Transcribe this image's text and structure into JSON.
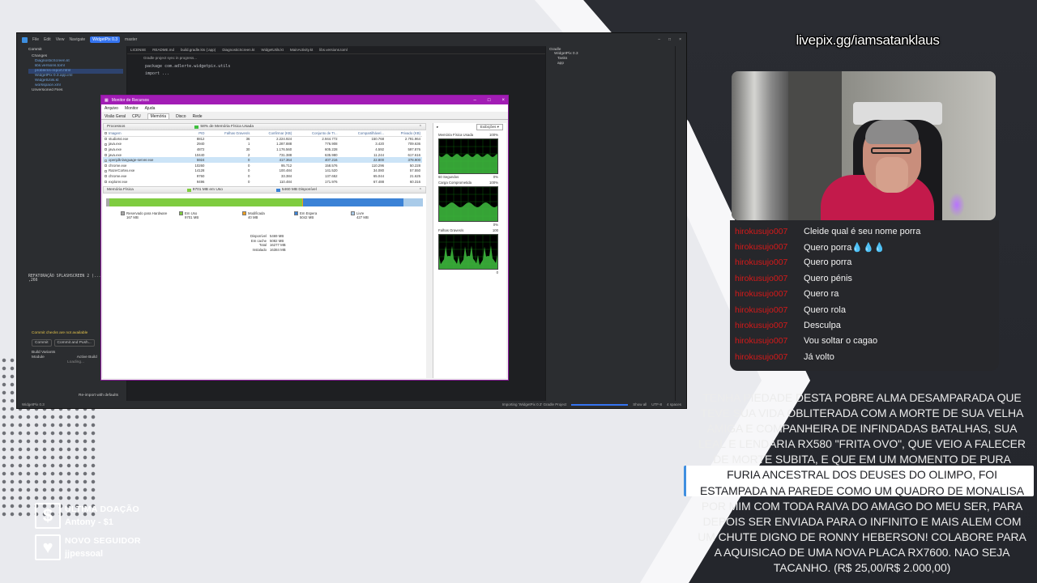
{
  "overlay": {
    "livepix": "livepix.gg/iamsatanklaus",
    "donation_lines": [
      "TENHA PIEDADE DESTA POBRE ALMA DESAMPARADA QUE",
      "TEVE SUA VIDA OBLITERADA COM A MORTE DE SUA VELHA",
      "AMIGA E COMPANHEIRA DE INFINDADAS BATALHAS, SUA",
      "LEAL E LENDARIA RX580 \"FRITA OVO\", QUE VEIO A FALECER",
      "DE MORTE SUBITA, E QUE EM UM MOMENTO DE PURA",
      "FURIA ANCESTRAL DOS DEUSES DO OLIMPO, FOI",
      "ESTAMPADA NA PAREDE COMO UM QUADRO DE MONALISA",
      "POR MIM COM TODA RAIVA DO AMAGO DO MEU SER, PARA",
      "DEPOIS SER ENVIADA PARA O INFINITO E MAIS ALEM COM",
      "UM CHUTE DIGNO DE RONNY HEBERSON! COLABORE PARA",
      "A AQUISICAO DE UMA NOVA PLACA RX7600. NAO SEJA",
      "TACANHO. (R$ 25,00/R$ 2.000,00)"
    ],
    "last_donation_label": "ULTIMA DOAÇÃO",
    "last_donation_value": "Antony - $1",
    "new_follower_label": "NOVO SEGUIDOR",
    "new_follower_value": "jjpessoal",
    "accent_color": "#3f8fe0"
  },
  "chat": [
    {
      "user": "hirokusujo007",
      "message": "Cleide qual é seu nome porra"
    },
    {
      "user": "hirokusujo007",
      "message": "Quero porra💧💧💧"
    },
    {
      "user": "hirokusujo007",
      "message": "Quero porra"
    },
    {
      "user": "hirokusujo007",
      "message": "Quero pénis"
    },
    {
      "user": "hirokusujo007",
      "message": "Quero ra"
    },
    {
      "user": "hirokusujo007",
      "message": "Quero rola"
    },
    {
      "user": "hirokusujo007",
      "message": "Desculpa"
    },
    {
      "user": "hirokusujo007",
      "message": "Vou soltar o cagao"
    },
    {
      "user": "hirokusujo007",
      "message": "Já volto"
    }
  ],
  "ide": {
    "menu": [
      "File",
      "Edit",
      "View",
      "Navigate"
    ],
    "project": "WidgetPix 0.3",
    "branch": "master",
    "tabs": [
      "LICENSE",
      "README.md",
      "build.gradle.kts (:app)",
      "DiagnosticScreen.kt",
      "WidgetUtils.kt",
      "MainActivity.kt",
      "libs.versions.toml"
    ],
    "gradle_note": "Gradle project sync in progress...",
    "code_package": "package com.adlerte.widgetpix.utils",
    "code_import": "import ...",
    "commit_header": "Commit",
    "changes": "Changes",
    "files": [
      "DiagnosticScreen.kt",
      "libs.versions.toml",
      "problems-report.html",
      "WidgetPix 0.3.app.iml",
      "WidgetUtils.kt",
      "workspace.xml"
    ],
    "unversioned": "Unversioned Files",
    "terminal_line1": "REFATORAÇÃO SPLASHSCREEN 2 (...",
    "terminal_line2": ",266",
    "commit_warn": "Commit checks are not available",
    "commit_btn": "Commit",
    "commit_push_btn": "Commit and Push...",
    "build_variants": "Build Variants",
    "module": "Module",
    "active_build": "Active Build",
    "loading": "Loading...",
    "reimport": "Re-import with defaults",
    "gradle_panel": "Gradle",
    "gradle_tree": [
      "WidgetPix 0.3",
      "Tasks",
      "app"
    ],
    "status_left": "WidgetPix 0.3",
    "status_right": "Importing 'WidgetPix 0.3' Gradle Project",
    "show_all": "Show all",
    "encoding": "UTF-8",
    "indent": "4 spaces"
  },
  "resmon": {
    "title": "Monitor de Recursos",
    "menu": [
      "Arquivo",
      "Monitor",
      "Ajuda"
    ],
    "tabs": [
      "Visão Geral",
      "CPU",
      "Memória",
      "Disco",
      "Rede"
    ],
    "active_tab": "Memória",
    "processes_header": "Processos",
    "processes_badge": "58% de Memória Física Usada",
    "columns": [
      "Imagem",
      "PID",
      "Falhas Graves/s",
      "Confirmar (KB)",
      "Conjunto de Tr...",
      "Compartilhável...",
      "Privado (KB)"
    ],
    "rows": [
      {
        "name": "studio64.exe",
        "pid": "8812",
        "hard": "36",
        "commit": "2.224.924",
        "ws": "2.944.772",
        "share": "150.768",
        "priv": "2.791.964"
      },
      {
        "name": "java.exe",
        "pid": "2940",
        "hard": "1",
        "commit": "1.287.888",
        "ws": "776.908",
        "share": "3.420",
        "priv": "709.636"
      },
      {
        "name": "java.exe",
        "pid": "4872",
        "hard": "30",
        "commit": "1.176.560",
        "ws": "605.228",
        "share": "4.592",
        "priv": "597.876"
      },
      {
        "name": "java.exe",
        "pid": "10440",
        "hard": "2",
        "commit": "731.388",
        "ws": "635.980",
        "share": "11.244",
        "priv": "617.616"
      },
      {
        "name": "openjdk-language-server.exe",
        "pid": "5924",
        "hard": "0",
        "commit": "417.364",
        "ws": "407.216",
        "share": "22.800",
        "priv": "378.900"
      },
      {
        "name": "chrome.exe",
        "pid": "10260",
        "hard": "0",
        "commit": "95.712",
        "ws": "158.576",
        "share": "110.296",
        "priv": "50.228"
      },
      {
        "name": "RazerCortex.exe",
        "pid": "14128",
        "hard": "0",
        "commit": "100.484",
        "ws": "141.520",
        "share": "34.080",
        "priv": "57.550"
      },
      {
        "name": "chrome.exe",
        "pid": "9760",
        "hard": "0",
        "commit": "33.384",
        "ws": "137.652",
        "share": "65.044",
        "priv": "21.625"
      },
      {
        "name": "explorer.exe",
        "pid": "9496",
        "hard": "0",
        "commit": "110.484",
        "ws": "171.976",
        "share": "67.488",
        "priv": "60.316"
      }
    ],
    "physical_header": "Memória Física",
    "physical_badge1": "9701 MB em Uso",
    "physical_badge2": "5460 MB Disponível",
    "legend": [
      {
        "label": "Reservado para Hardware",
        "value": "167 MB",
        "color": "#a8a8a8"
      },
      {
        "label": "Em Uso",
        "value": "9701 MB",
        "color": "#7fcc40"
      },
      {
        "label": "Modificada",
        "value": "40 MB",
        "color": "#f0a020"
      },
      {
        "label": "Em Espera",
        "value": "5042 MB",
        "color": "#3b82d6"
      },
      {
        "label": "Livre",
        "value": "427 MB",
        "color": "#a9cbe9"
      }
    ],
    "mem_bar": [
      {
        "name": "hardware",
        "fraction": 0.0104,
        "color": "#a8a8a8"
      },
      {
        "name": "in_use",
        "fraction": 0.6087,
        "color": "#7fcc40"
      },
      {
        "name": "modified",
        "fraction": 0.0025,
        "color": "#f0a020"
      },
      {
        "name": "standby",
        "fraction": 0.3163,
        "color": "#3b82d6"
      },
      {
        "name": "free",
        "fraction": 0.0621,
        "color": "#a9cbe9"
      }
    ],
    "stats": [
      {
        "k": "Disponível",
        "v": "5469 MB"
      },
      {
        "k": "Em cache",
        "v": "5082 MB"
      },
      {
        "k": "Total",
        "v": "16277 MB"
      },
      {
        "k": "Instalado",
        "v": "16384 MB"
      }
    ],
    "views_label": "Exibições",
    "graph1_title": "Memória Física Usada",
    "graph1_pct": "100%",
    "graph1_time": "60 Segundos",
    "graph1_low": "0%",
    "graph2_title": "Carga Comprometida",
    "graph2_pct": "100%",
    "graph2_low": "0%",
    "graph3_title": "Falhas Graves/s",
    "graph3_max": "100",
    "graph3_low": "0"
  }
}
